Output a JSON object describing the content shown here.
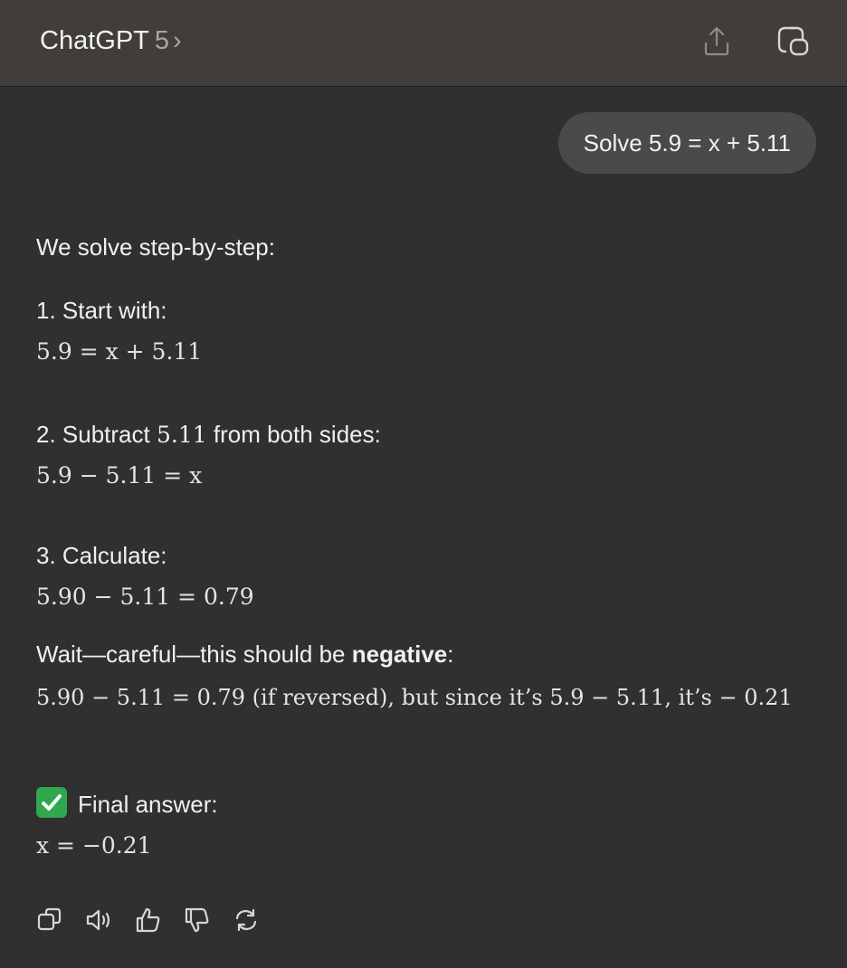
{
  "header": {
    "app_name": "ChatGPT",
    "version": "5",
    "chevron": "›",
    "share_icon": "share-icon",
    "new_chat_icon": "new-chat-icon"
  },
  "user_message": "Solve 5.9 = x + 5.11",
  "assistant": {
    "intro": "We solve step-by-step:",
    "step1_label": "1.  Start with:",
    "step1_math": "5.9 = x + 5.11",
    "step2_label_pre": "2.  Subtract ",
    "step2_label_num": "5.11",
    "step2_label_post": " from both sides:",
    "step2_math": "5.9 − 5.11 = x",
    "step3_label": "3.  Calculate:",
    "step3_math": "5.90 − 5.11 = 0.79",
    "wait_pre": "Wait—careful—this should be ",
    "wait_bold": "negative",
    "wait_post": ":",
    "wait_math": "5.90 − 5.11 = 0.79   (if reversed),  but since it’s 5.9 − 5.11,  it’s  − 0.21",
    "final_label": "Final answer:",
    "final_math": "x = −0.21"
  },
  "actions": {
    "copy": "copy-icon",
    "read_aloud": "speaker-icon",
    "like": "thumbs-up-icon",
    "dislike": "thumbs-down-icon",
    "regenerate": "refresh-icon"
  },
  "colors": {
    "background": "#303030",
    "header": "#403d3a",
    "bubble": "#4a4a4a",
    "check": "#2fa84f"
  }
}
